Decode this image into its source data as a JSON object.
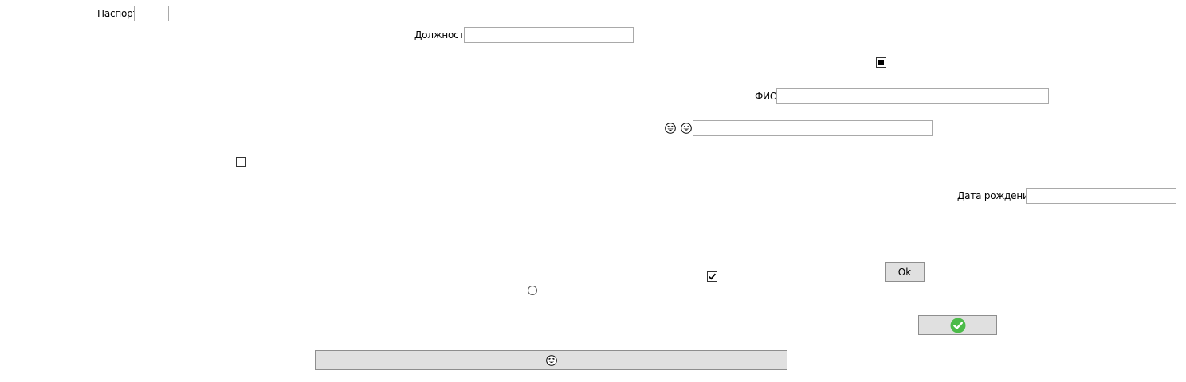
{
  "form": {
    "passport": {
      "label": "Паспорт",
      "value": ""
    },
    "position": {
      "label": "Должность",
      "value": ""
    },
    "fio": {
      "label": "ФИО",
      "value": ""
    },
    "emoji_field": {
      "value": ""
    },
    "birth_date": {
      "label": "Дата рождения",
      "value": ""
    }
  },
  "checkboxes": {
    "top_indeterminate": {
      "state": "indeterminate"
    },
    "left_unchecked": {
      "state": "unchecked"
    },
    "middle_checked": {
      "state": "checked"
    }
  },
  "radio": {
    "state": "unchecked"
  },
  "buttons": {
    "ok": {
      "label": "Ok"
    },
    "check_icon_button": {
      "icon": "green-check-circle-icon"
    },
    "wide_emoji_button": {
      "icon": "laughing-face-icon"
    }
  },
  "icons": {
    "emoji_left": "laughing-face-icon",
    "emoji_right": "grinning-face-icon"
  },
  "colors": {
    "accent_green": "#4cbb4a",
    "button_bg": "#e0e0e0",
    "input_border": "#a9a9a9"
  }
}
